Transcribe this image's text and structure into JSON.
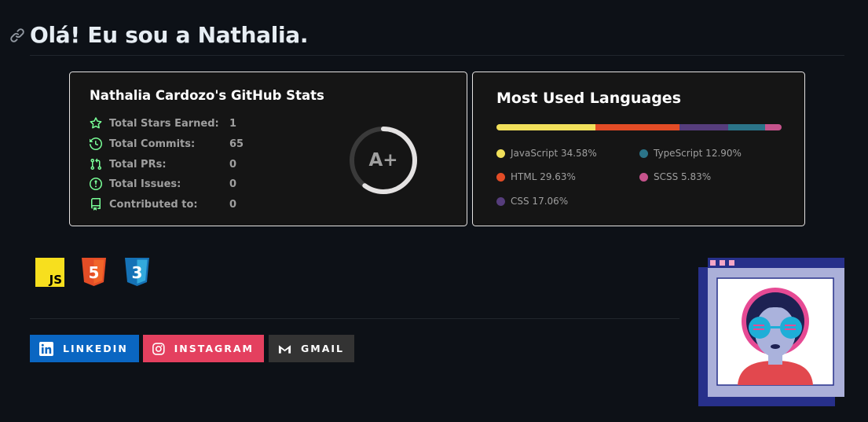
{
  "page": {
    "heading": "Olá! Eu sou a Nathalia."
  },
  "stats_card": {
    "title": "Nathalia Cardozo's GitHub Stats",
    "rank": "A+",
    "rank_progress_percent": 60,
    "rows": [
      {
        "icon": "star-icon",
        "label": "Total Stars Earned:",
        "value": "1"
      },
      {
        "icon": "history-icon",
        "label": "Total Commits:",
        "value": "65"
      },
      {
        "icon": "pull-request-icon",
        "label": "Total PRs:",
        "value": "0"
      },
      {
        "icon": "issue-icon",
        "label": "Total Issues:",
        "value": "0"
      },
      {
        "icon": "repo-icon",
        "label": "Contributed to:",
        "value": "0"
      }
    ],
    "colors": {
      "icon": "#79ff97",
      "ring": "#e4e2e2",
      "text": "#9f9f9f"
    }
  },
  "languages_card": {
    "title": "Most Used Languages",
    "languages": [
      {
        "name": "JavaScript",
        "percent": 34.58,
        "label": "JavaScript 34.58%",
        "color": "#f1e05a"
      },
      {
        "name": "HTML",
        "percent": 29.63,
        "label": "HTML 29.63%",
        "color": "#e34c26"
      },
      {
        "name": "CSS",
        "percent": 17.06,
        "label": "CSS 17.06%",
        "color": "#563d7c"
      },
      {
        "name": "TypeScript",
        "percent": 12.9,
        "label": "TypeScript 12.90%",
        "color": "#2b7489"
      },
      {
        "name": "SCSS",
        "percent": 5.83,
        "label": "SCSS 5.83%",
        "color": "#c6538c"
      }
    ]
  },
  "tech_icons": [
    {
      "name": "javascript-icon",
      "text": "JS",
      "color": "#f7df1e"
    },
    {
      "name": "html5-icon",
      "text": "5",
      "color": "#e44d26"
    },
    {
      "name": "css3-icon",
      "text": "3",
      "color": "#1572b6"
    }
  ],
  "badges": {
    "linkedin": {
      "label": "LINKEDIN",
      "icon": "linkedin-icon",
      "color": "#0a66c2"
    },
    "instagram": {
      "label": "INSTAGRAM",
      "icon": "instagram-icon",
      "color": "#e4405f"
    },
    "gmail": {
      "label": "GMAIL",
      "icon": "gmail-icon",
      "color": "#333333"
    }
  }
}
